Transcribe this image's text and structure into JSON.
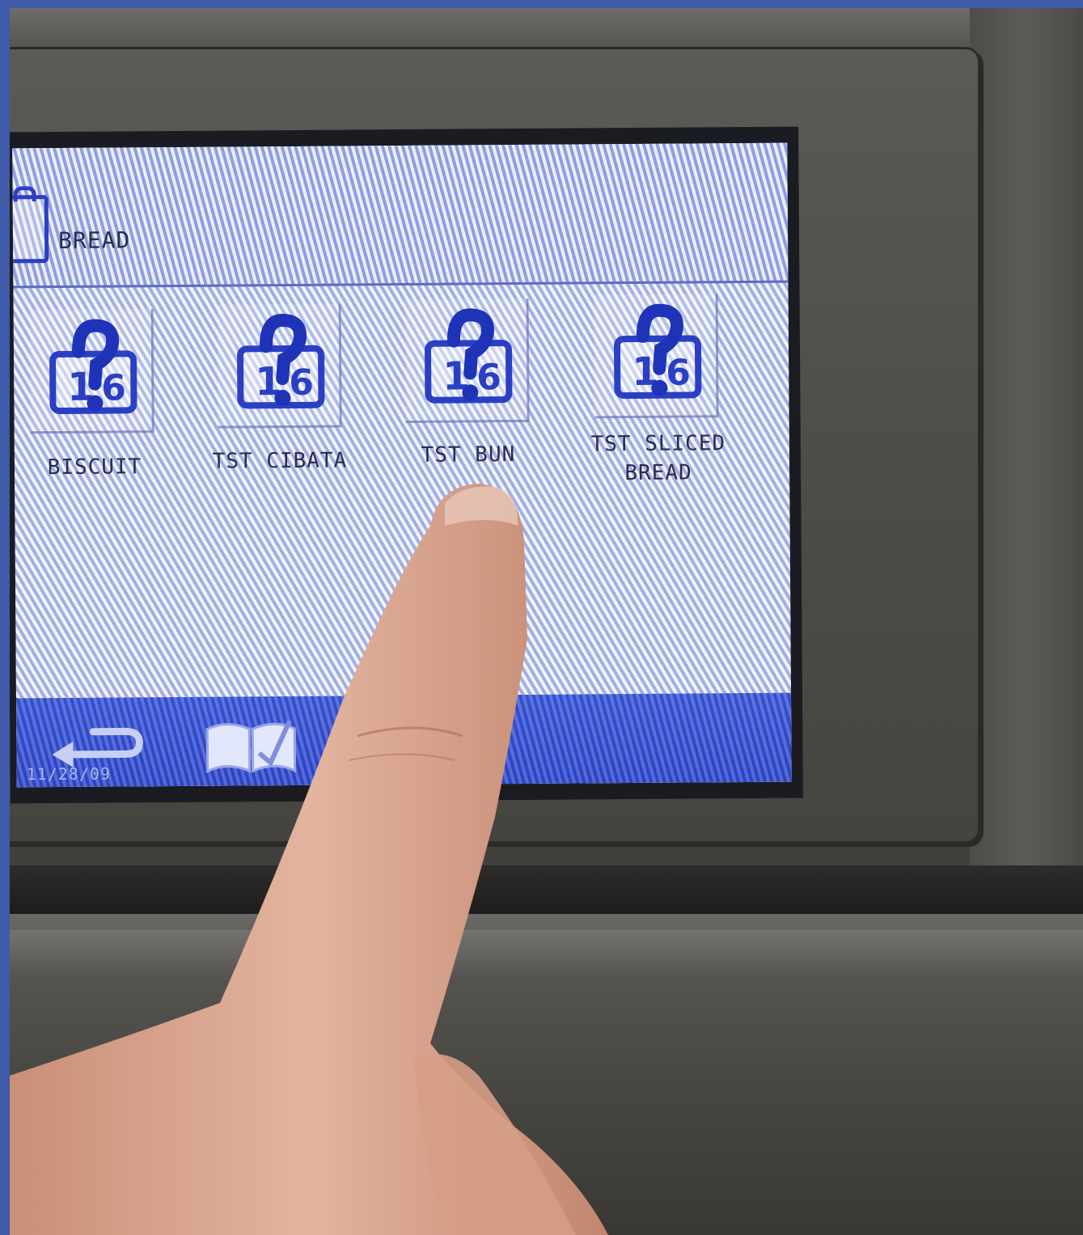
{
  "screen": {
    "title": "BREAD",
    "tiles": [
      {
        "label": "BISCUIT"
      },
      {
        "label": "TST CIBATA"
      },
      {
        "label": "TST BUN"
      },
      {
        "label": "TST SLICED",
        "label_line2": "BREAD"
      }
    ],
    "footer": {
      "date": "11/28/09"
    }
  },
  "icons": {
    "title": "bread-bag-icon",
    "tile": "question-mark-bag-icon",
    "back": "back-arrow-icon",
    "book": "recipe-book-icon"
  },
  "colors": {
    "screen_bg": "#c8d2f2",
    "icon_blue": "#2b3fc4",
    "navbar_blue": "#3450d2",
    "text": "#2a2d4a"
  }
}
